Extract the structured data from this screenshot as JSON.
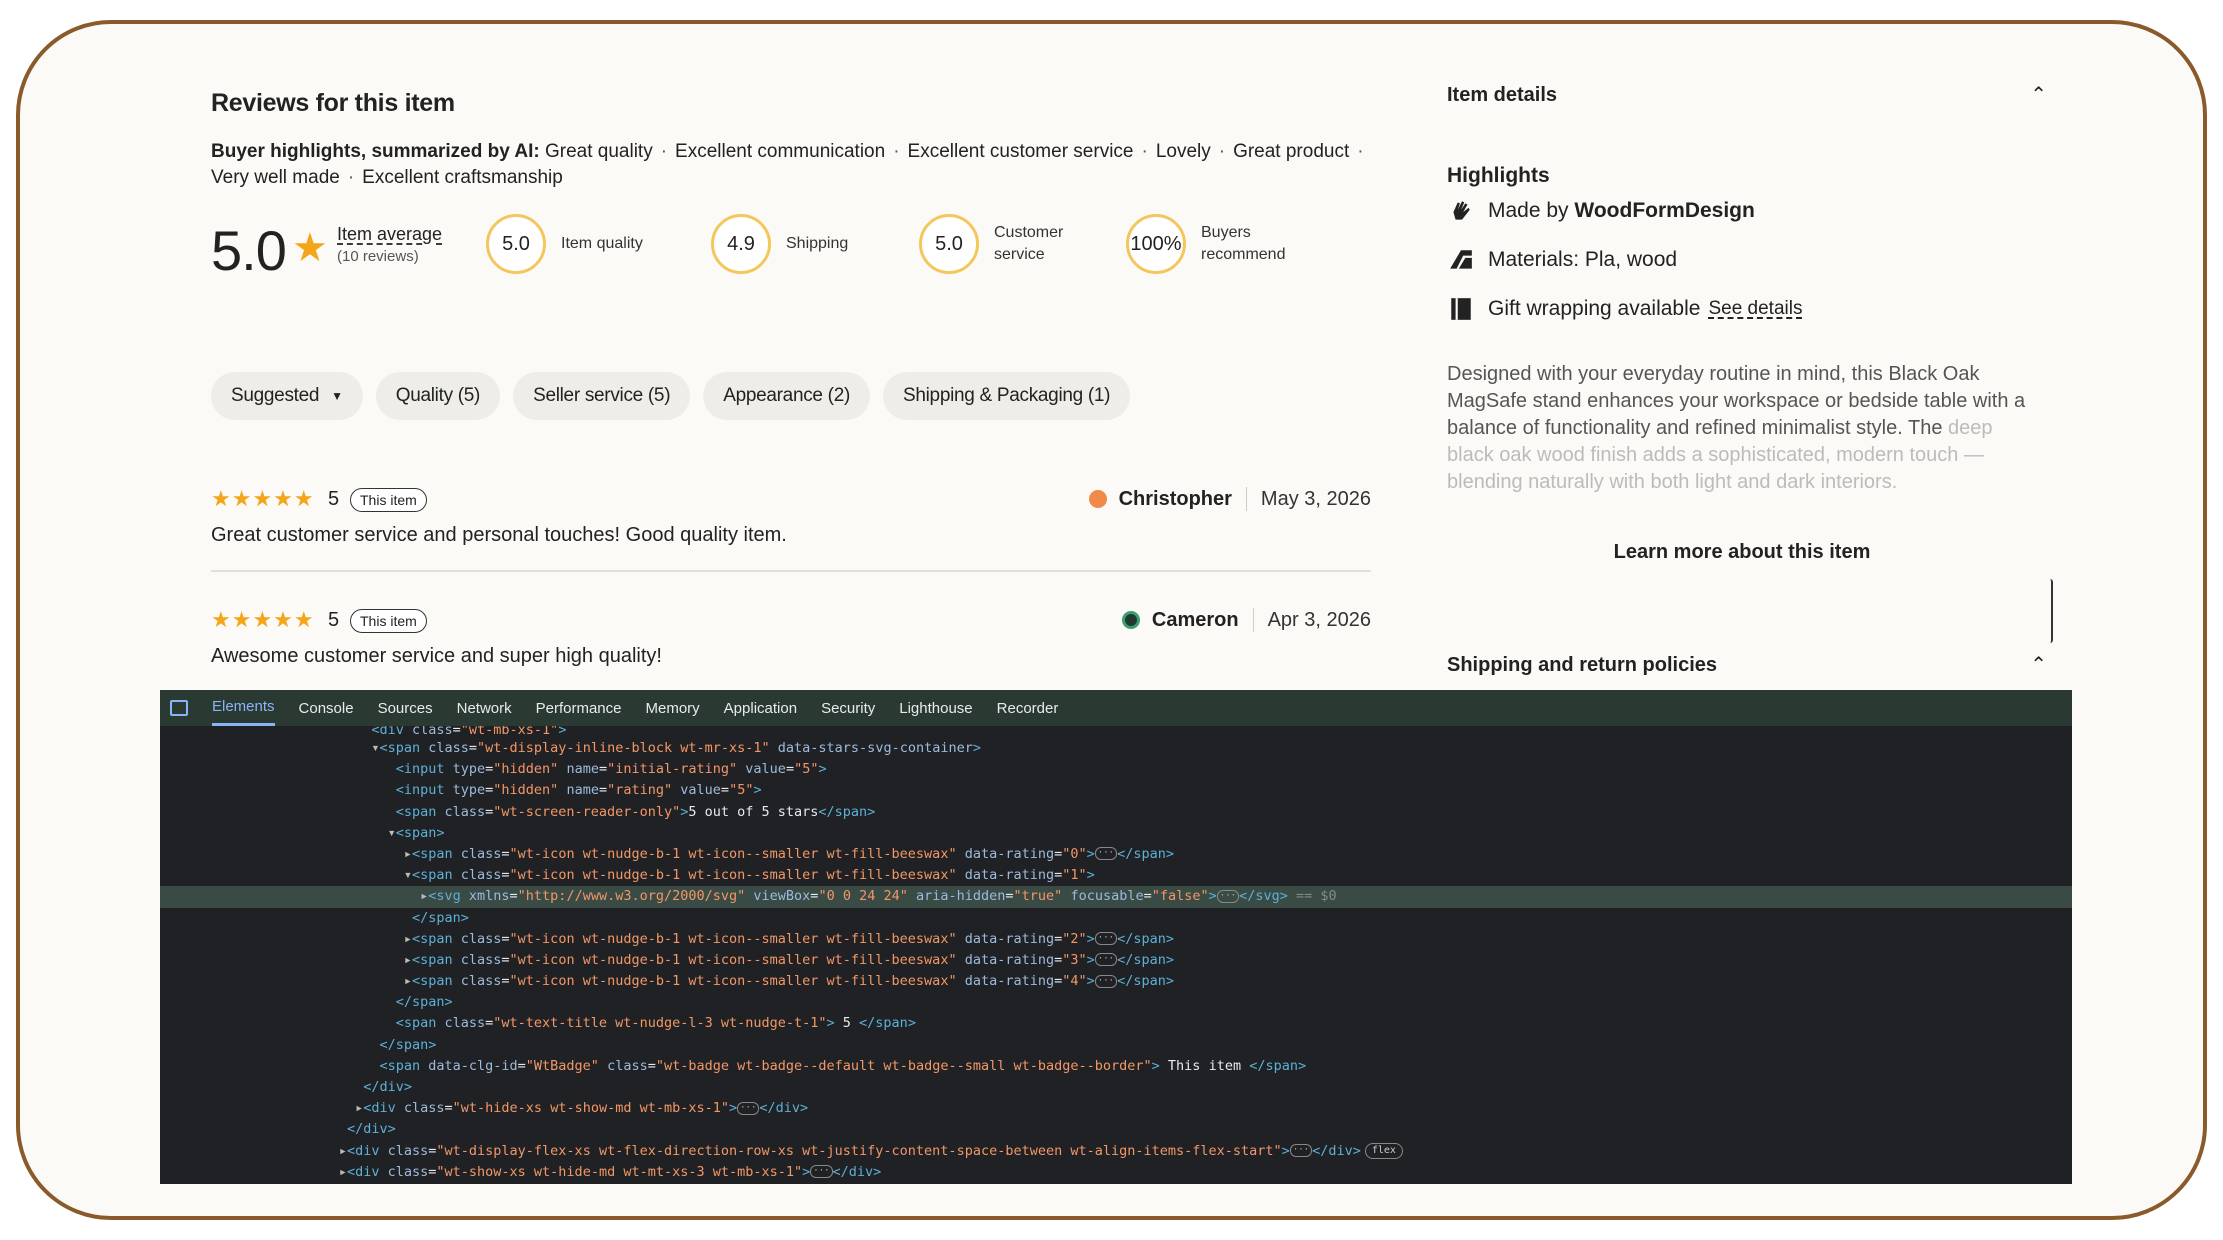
{
  "reviews": {
    "title": "Reviews for this item",
    "buyer_highlights_label": "Buyer highlights, summarized by AI:",
    "buyer_highlights": [
      "Great quality",
      "Excellent communication",
      "Excellent customer service",
      "Lovely",
      "Great product",
      "Very well made",
      "Excellent craftsmanship"
    ],
    "overall_score": "5.0",
    "item_average_label": "Item average",
    "review_count": "(10 reviews)",
    "metrics": [
      {
        "value": "5.0",
        "label_line1": "Item quality",
        "label_line2": ""
      },
      {
        "value": "4.9",
        "label_line1": "Shipping",
        "label_line2": ""
      },
      {
        "value": "5.0",
        "label_line1": "Customer",
        "label_line2": "service"
      },
      {
        "value": "100%",
        "label_line1": "Buyers",
        "label_line2": "recommend"
      }
    ],
    "filters": [
      "Suggested",
      "Quality (5)",
      "Seller service (5)",
      "Appearance (2)",
      "Shipping & Packaging (1)"
    ],
    "items": [
      {
        "stars": "★★★★★",
        "rating": "5",
        "badge": "This item",
        "author": "Christopher",
        "date": "May 3, 2026",
        "text": "Great customer service and personal touches! Good quality item.",
        "avatar_color": "#f08a4b"
      },
      {
        "stars": "★★★★★",
        "rating": "5",
        "badge": "This item",
        "author": "Cameron",
        "date": "Apr 3, 2026",
        "text": "Awesome customer service and super high quality!",
        "avatar_color": "#1f3a2e"
      }
    ]
  },
  "details": {
    "item_details_title": "Item details",
    "highlights_title": "Highlights",
    "made_by_prefix": "Made by",
    "made_by_shop": "WoodFormDesign",
    "materials": "Materials: Pla, wood",
    "gift_wrapping": "Gift wrapping available",
    "see_details": "See details",
    "description": "Designed with your everyday routine in mind, this Black Oak MagSafe stand enhances your workspace or bedside table with a balance of functionality and refined minimalist style. The",
    "description_faded": "deep black oak wood finish adds a sophisticated, modern touch — blending naturally with both light and dark interiors.",
    "learn_more": "Learn more about this item",
    "shipping_title": "Shipping and return policies"
  },
  "devtools": {
    "tabs": [
      "Elements",
      "Console",
      "Sources",
      "Network",
      "Performance",
      "Memory",
      "Application",
      "Security",
      "Lighthouse",
      "Recorder"
    ],
    "active_tab": "Elements"
  },
  "colors": {
    "accent_star": "#f4a61b",
    "frame_border": "#8a5a2b",
    "circle_border": "#f4c75d",
    "devtools_bg": "#202124",
    "devtools_tabbar": "#2a3a33"
  }
}
